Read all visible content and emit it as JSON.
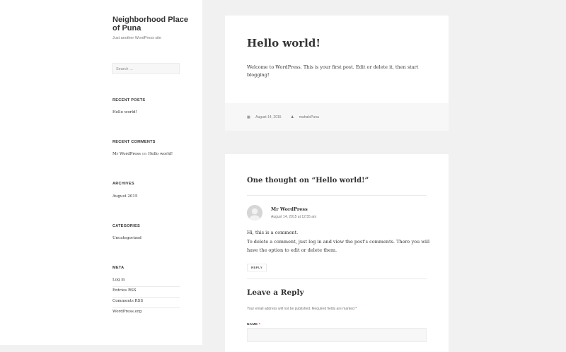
{
  "site": {
    "title": "Neighborhood Place of Puna",
    "description": "Just another WordPress site"
  },
  "search": {
    "placeholder": "Search …"
  },
  "widgets": {
    "recent_posts": {
      "title": "RECENT POSTS",
      "items": [
        "Hello world!"
      ]
    },
    "recent_comments": {
      "title": "RECENT COMMENTS",
      "author": "Mr WordPress",
      "on": "on",
      "post": "Hello world!"
    },
    "archives": {
      "title": "ARCHIVES",
      "items": [
        "August 2015"
      ]
    },
    "categories": {
      "title": "CATEGORIES",
      "items": [
        "Uncategorized"
      ]
    },
    "meta": {
      "title": "META",
      "items": [
        "Log in",
        "Entries RSS",
        "Comments RSS",
        "WordPress.org"
      ]
    }
  },
  "post": {
    "title": "Hello world!",
    "body": "Welcome to WordPress. This is your first post. Edit or delete it, then start blogging!",
    "date": "August 14, 2015",
    "author": "mahaloPuna",
    "date_icon": "calendar-icon",
    "author_icon": "person-icon"
  },
  "comments": {
    "title": "One thought on “Hello world!”",
    "comment": {
      "author": "Mr WordPress",
      "date": "August 14, 2015 at 12:55 am",
      "line1": "Hi, this is a comment.",
      "line2": "To delete a comment, just log in and view the post's comments. There you will have the option to edit or delete them.",
      "reply_label": "REPLY"
    },
    "reply": {
      "title": "Leave a Reply",
      "notes": "Your email address will not be published. Required fields are marked",
      "required_mark": "*",
      "name_label": "NAME",
      "name_required": "*"
    }
  }
}
